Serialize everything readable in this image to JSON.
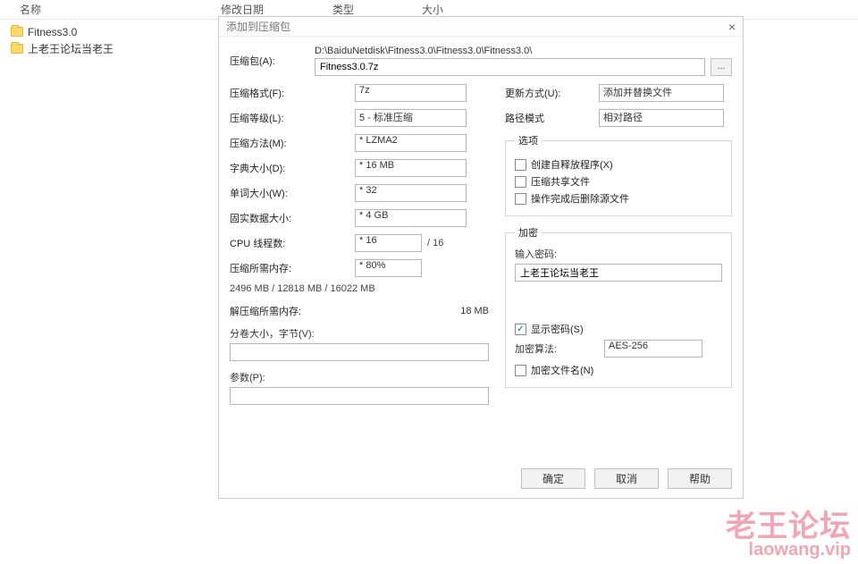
{
  "explorer": {
    "columns": {
      "name": "名称",
      "modified": "修改日期",
      "type": "类型",
      "size": "大小"
    },
    "items": [
      {
        "label": "Fitness3.0"
      },
      {
        "label": "上老王论坛当老王"
      }
    ]
  },
  "dialog": {
    "title": "添加到压缩包",
    "archive_label": "压缩包(A):",
    "archive_path": "D:\\BaiduNetdisk\\Fitness3.0\\Fitness3.0\\Fitness3.0\\",
    "archive_name": "Fitness3.0.7z",
    "browse_label": "...",
    "left": {
      "format": {
        "label": "压缩格式(F):",
        "value": "7z"
      },
      "level": {
        "label": "压缩等级(L):",
        "value": "5 - 标准压缩"
      },
      "method": {
        "label": "压缩方法(M):",
        "value": "* LZMA2"
      },
      "dict": {
        "label": "字典大小(D):",
        "value": "* 16 MB"
      },
      "word": {
        "label": "单词大小(W):",
        "value": "* 32"
      },
      "solid": {
        "label": "固实数据大小:",
        "value": "* 4 GB"
      },
      "threads": {
        "label": "CPU 线程数:",
        "value": "* 16",
        "total": "/ 16"
      },
      "mem_compress_label": "压缩所需内存:",
      "mem_compress_value": "2496 MB / 12818 MB / 16022 MB",
      "mem_pct": "* 80%",
      "mem_decompress_label": "解压缩所需内存:",
      "mem_decompress_value": "18 MB",
      "split_label": "分卷大小，字节(V):",
      "params_label": "参数(P):"
    },
    "right": {
      "update": {
        "label": "更新方式(U):",
        "value": "添加并替换文件"
      },
      "pathmode": {
        "label": "路径模式",
        "value": "相对路径"
      },
      "options_legend": "选项",
      "opt_sfx": "创建自释放程序(X)",
      "opt_shared": "压缩共享文件",
      "opt_delete": "操作完成后删除源文件",
      "enc_legend": "加密",
      "pw_label": "输入密码:",
      "pw_value": "上老王论坛当老王",
      "show_pw": "显示密码(S)",
      "enc_method_label": "加密算法:",
      "enc_method_value": "AES-256",
      "enc_names": "加密文件名(N)"
    },
    "buttons": {
      "ok": "确定",
      "cancel": "取消",
      "help": "帮助"
    }
  },
  "watermark": {
    "line1": "老王论坛",
    "line2": "laowang.vip"
  }
}
